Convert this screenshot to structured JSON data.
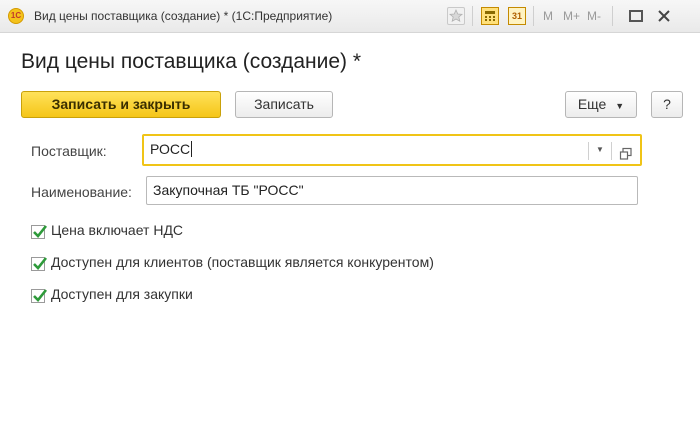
{
  "window": {
    "logo_text": "1C",
    "title": "Вид цены поставщика (создание) * (1С:Предприятие)",
    "memory_buttons": [
      "M",
      "M+",
      "M-"
    ],
    "calendar_day": "31"
  },
  "form": {
    "title": "Вид цены поставщика (создание) *",
    "toolbar": {
      "save_close_label": "Записать и закрыть",
      "save_label": "Записать",
      "more_label": "Еще",
      "help_label": "?"
    },
    "supplier": {
      "label": "Поставщик:",
      "value": "РОСС"
    },
    "name": {
      "label": "Наименование:",
      "value": "Закупочная ТБ \"РОСС\""
    },
    "checkboxes": [
      {
        "label": "Цена включает НДС",
        "checked": true
      },
      {
        "label": "Доступен для клиентов (поставщик является конкурентом)",
        "checked": true
      },
      {
        "label": "Доступен для закупки",
        "checked": true
      }
    ]
  },
  "colors": {
    "accent": "#f5c518",
    "check": "#2e9a3a"
  }
}
